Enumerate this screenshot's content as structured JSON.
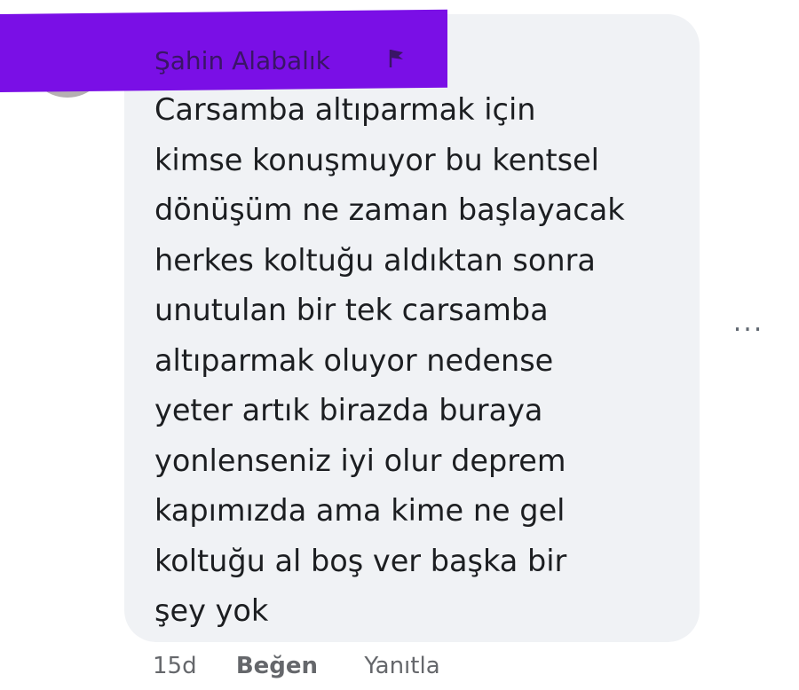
{
  "comment": {
    "author": "Şahin Alabalık",
    "text_lines": [
      "Carsamba altıparmak için",
      "kimse konuşmuyor bu kentsel",
      "dönüşüm ne zaman başlayacak",
      "herkes koltuğu aldıktan sonra",
      "unutulan bir tek carsamba",
      "altıparmak oluyor nedense",
      "yeter artık birazda buraya",
      "yonlenseniz iyi olur deprem",
      "kapımızda ama kime ne gel",
      "koltuğu al boş ver başka bir",
      "şey yok"
    ],
    "more_label": "...",
    "flag_icon": "flag-icon",
    "highlight_color": "#7a0fe6"
  },
  "actions": {
    "time": "15d",
    "like_label": "Beğen",
    "reply_label": "Yanıtla"
  }
}
